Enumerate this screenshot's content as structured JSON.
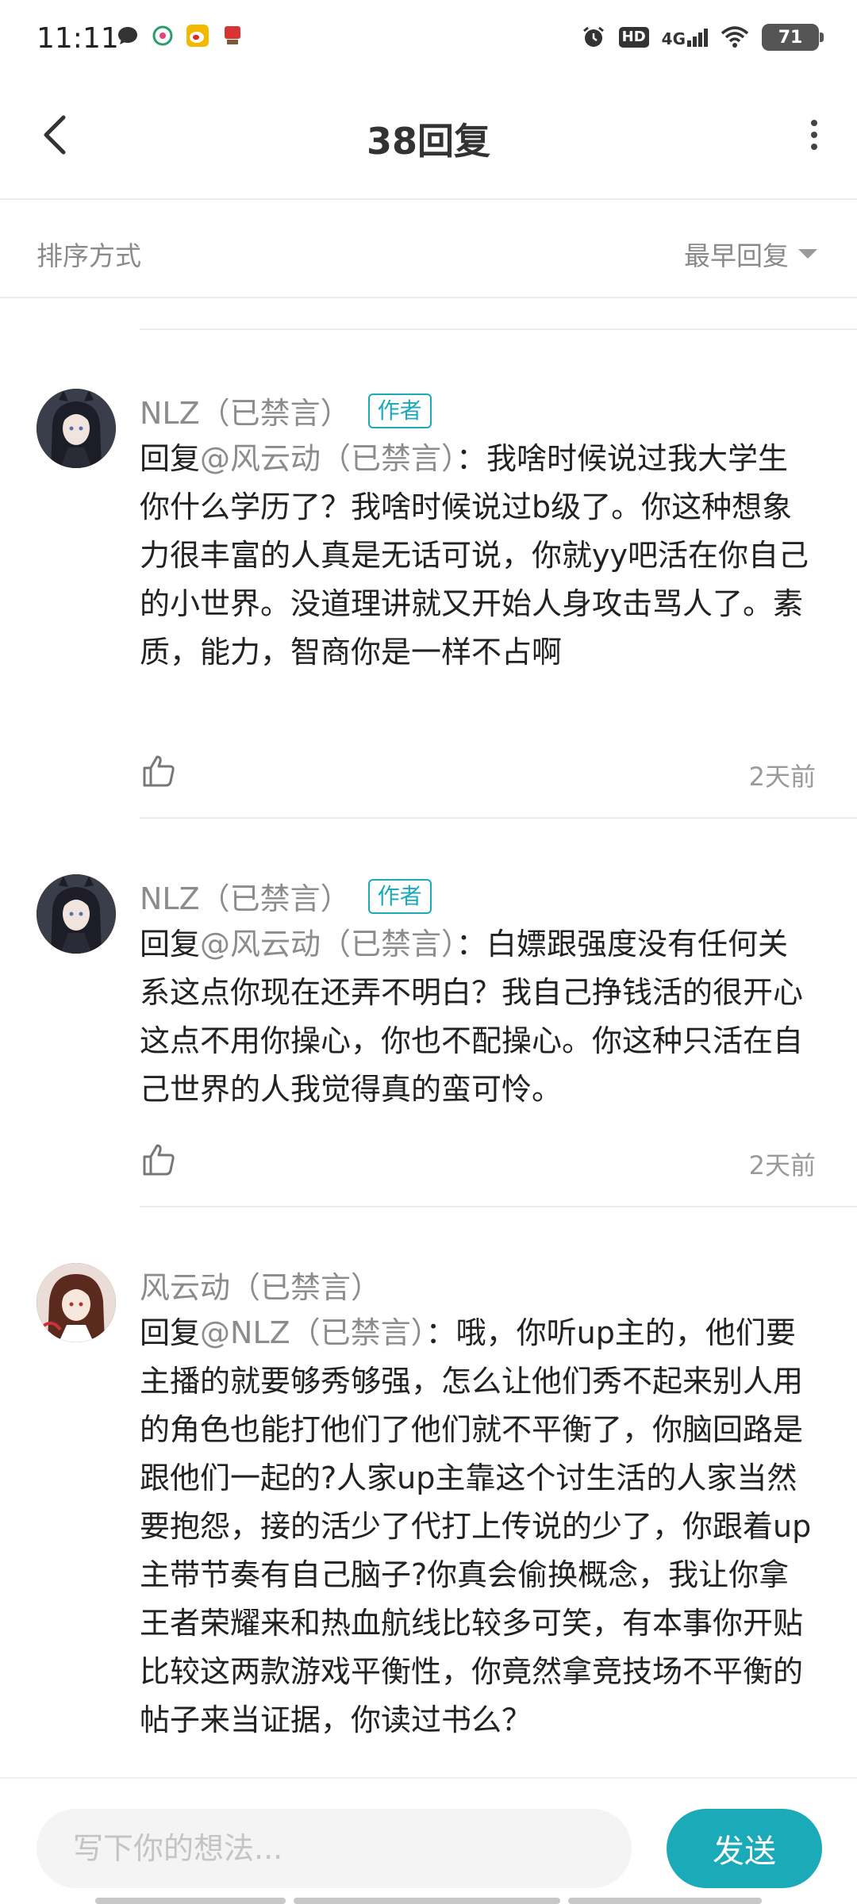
{
  "status_bar": {
    "time": "11:11",
    "left_icons": [
      "chat-bubble-icon",
      "app-icon",
      "weibo-icon",
      "app-logo-icon"
    ],
    "right_icons": [
      "alarm-icon",
      "hd-icon",
      "signal-icon",
      "wifi-icon",
      "battery-icon"
    ],
    "hd_label": "HD",
    "network_label": "4G",
    "battery": "71"
  },
  "header": {
    "title": "38回复",
    "back_icon": "chevron-left-icon",
    "more_icon": "more-vertical-icon"
  },
  "sort": {
    "label": "排序方式",
    "selected": "最早回复",
    "icon": "caret-down-icon"
  },
  "comments": [
    {
      "username": "NLZ（已禁言）",
      "badge": "作者",
      "reply_prefix": "回复",
      "mention": "@风云动（已禁言）",
      "separator": "：",
      "text": "我啥时候说过我大学生你什么学历了？我啥时候说过b级了。你这种想象力很丰富的人真是无话可说，你就yy吧活在你自己的小世界。没道理讲就又开始人身攻击骂人了。素质，能力，智商你是一样不占啊",
      "time": "2天前"
    },
    {
      "username": "NLZ（已禁言）",
      "badge": "作者",
      "reply_prefix": "回复",
      "mention": "@风云动（已禁言）",
      "separator": "：",
      "text": "白嫖跟强度没有任何关系这点你现在还弄不明白？我自己挣钱活的很开心这点不用你操心，你也不配操心。你这种只活在自己世界的人我觉得真的蛮可怜。",
      "time": "2天前"
    },
    {
      "username": "风云动（已禁言）",
      "badge": "",
      "reply_prefix": "回复",
      "mention": "@NLZ（已禁言）",
      "separator": "：",
      "text": "哦，你听up主的，他们要主播的就要够秀够强，怎么让他们秀不起来别人用的角色也能打他们了他们就不平衡了，你脑回路是跟他们一起的?人家up主靠这个讨生活的人家当然要抱怨，接的活少了代打上传说的少了，你跟着up主带节奏有自己脑子?你真会偷换概念，我让你拿王者荣耀来和热血航线比较多可笑，有本事你开贴比较这两款游戏平衡性，你竟然拿竞技场不平衡的帖子来当证据，你读过书么？",
      "time": ""
    }
  ],
  "composer": {
    "placeholder": "写下你的想法...",
    "send_label": "发送"
  },
  "colors": {
    "accent": "#1aaab8",
    "muted_text": "#8c8c8c",
    "body_text": "#222222",
    "divider": "#ececec"
  }
}
